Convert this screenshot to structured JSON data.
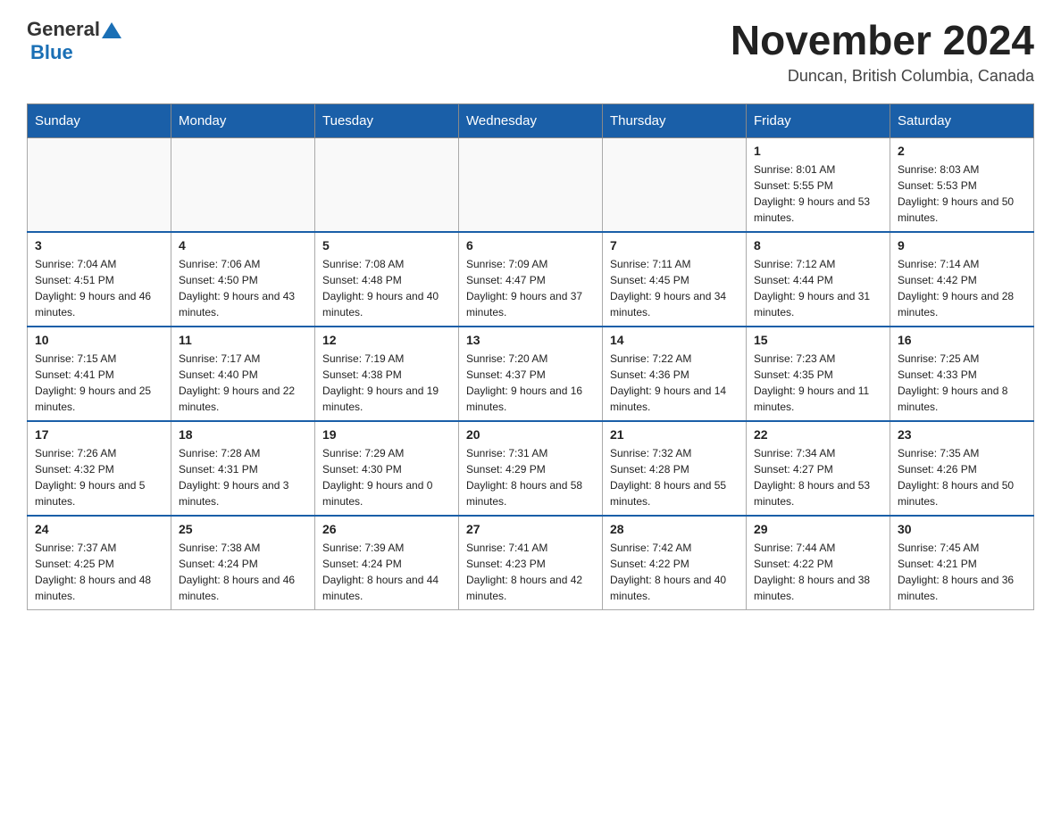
{
  "header": {
    "logo_general": "General",
    "logo_blue": "Blue",
    "month_title": "November 2024",
    "location": "Duncan, British Columbia, Canada"
  },
  "days_of_week": [
    "Sunday",
    "Monday",
    "Tuesday",
    "Wednesday",
    "Thursday",
    "Friday",
    "Saturday"
  ],
  "weeks": [
    {
      "days": [
        {
          "number": "",
          "info": ""
        },
        {
          "number": "",
          "info": ""
        },
        {
          "number": "",
          "info": ""
        },
        {
          "number": "",
          "info": ""
        },
        {
          "number": "",
          "info": ""
        },
        {
          "number": "1",
          "info": "Sunrise: 8:01 AM\nSunset: 5:55 PM\nDaylight: 9 hours and 53 minutes."
        },
        {
          "number": "2",
          "info": "Sunrise: 8:03 AM\nSunset: 5:53 PM\nDaylight: 9 hours and 50 minutes."
        }
      ]
    },
    {
      "days": [
        {
          "number": "3",
          "info": "Sunrise: 7:04 AM\nSunset: 4:51 PM\nDaylight: 9 hours and 46 minutes."
        },
        {
          "number": "4",
          "info": "Sunrise: 7:06 AM\nSunset: 4:50 PM\nDaylight: 9 hours and 43 minutes."
        },
        {
          "number": "5",
          "info": "Sunrise: 7:08 AM\nSunset: 4:48 PM\nDaylight: 9 hours and 40 minutes."
        },
        {
          "number": "6",
          "info": "Sunrise: 7:09 AM\nSunset: 4:47 PM\nDaylight: 9 hours and 37 minutes."
        },
        {
          "number": "7",
          "info": "Sunrise: 7:11 AM\nSunset: 4:45 PM\nDaylight: 9 hours and 34 minutes."
        },
        {
          "number": "8",
          "info": "Sunrise: 7:12 AM\nSunset: 4:44 PM\nDaylight: 9 hours and 31 minutes."
        },
        {
          "number": "9",
          "info": "Sunrise: 7:14 AM\nSunset: 4:42 PM\nDaylight: 9 hours and 28 minutes."
        }
      ]
    },
    {
      "days": [
        {
          "number": "10",
          "info": "Sunrise: 7:15 AM\nSunset: 4:41 PM\nDaylight: 9 hours and 25 minutes."
        },
        {
          "number": "11",
          "info": "Sunrise: 7:17 AM\nSunset: 4:40 PM\nDaylight: 9 hours and 22 minutes."
        },
        {
          "number": "12",
          "info": "Sunrise: 7:19 AM\nSunset: 4:38 PM\nDaylight: 9 hours and 19 minutes."
        },
        {
          "number": "13",
          "info": "Sunrise: 7:20 AM\nSunset: 4:37 PM\nDaylight: 9 hours and 16 minutes."
        },
        {
          "number": "14",
          "info": "Sunrise: 7:22 AM\nSunset: 4:36 PM\nDaylight: 9 hours and 14 minutes."
        },
        {
          "number": "15",
          "info": "Sunrise: 7:23 AM\nSunset: 4:35 PM\nDaylight: 9 hours and 11 minutes."
        },
        {
          "number": "16",
          "info": "Sunrise: 7:25 AM\nSunset: 4:33 PM\nDaylight: 9 hours and 8 minutes."
        }
      ]
    },
    {
      "days": [
        {
          "number": "17",
          "info": "Sunrise: 7:26 AM\nSunset: 4:32 PM\nDaylight: 9 hours and 5 minutes."
        },
        {
          "number": "18",
          "info": "Sunrise: 7:28 AM\nSunset: 4:31 PM\nDaylight: 9 hours and 3 minutes."
        },
        {
          "number": "19",
          "info": "Sunrise: 7:29 AM\nSunset: 4:30 PM\nDaylight: 9 hours and 0 minutes."
        },
        {
          "number": "20",
          "info": "Sunrise: 7:31 AM\nSunset: 4:29 PM\nDaylight: 8 hours and 58 minutes."
        },
        {
          "number": "21",
          "info": "Sunrise: 7:32 AM\nSunset: 4:28 PM\nDaylight: 8 hours and 55 minutes."
        },
        {
          "number": "22",
          "info": "Sunrise: 7:34 AM\nSunset: 4:27 PM\nDaylight: 8 hours and 53 minutes."
        },
        {
          "number": "23",
          "info": "Sunrise: 7:35 AM\nSunset: 4:26 PM\nDaylight: 8 hours and 50 minutes."
        }
      ]
    },
    {
      "days": [
        {
          "number": "24",
          "info": "Sunrise: 7:37 AM\nSunset: 4:25 PM\nDaylight: 8 hours and 48 minutes."
        },
        {
          "number": "25",
          "info": "Sunrise: 7:38 AM\nSunset: 4:24 PM\nDaylight: 8 hours and 46 minutes."
        },
        {
          "number": "26",
          "info": "Sunrise: 7:39 AM\nSunset: 4:24 PM\nDaylight: 8 hours and 44 minutes."
        },
        {
          "number": "27",
          "info": "Sunrise: 7:41 AM\nSunset: 4:23 PM\nDaylight: 8 hours and 42 minutes."
        },
        {
          "number": "28",
          "info": "Sunrise: 7:42 AM\nSunset: 4:22 PM\nDaylight: 8 hours and 40 minutes."
        },
        {
          "number": "29",
          "info": "Sunrise: 7:44 AM\nSunset: 4:22 PM\nDaylight: 8 hours and 38 minutes."
        },
        {
          "number": "30",
          "info": "Sunrise: 7:45 AM\nSunset: 4:21 PM\nDaylight: 8 hours and 36 minutes."
        }
      ]
    }
  ]
}
